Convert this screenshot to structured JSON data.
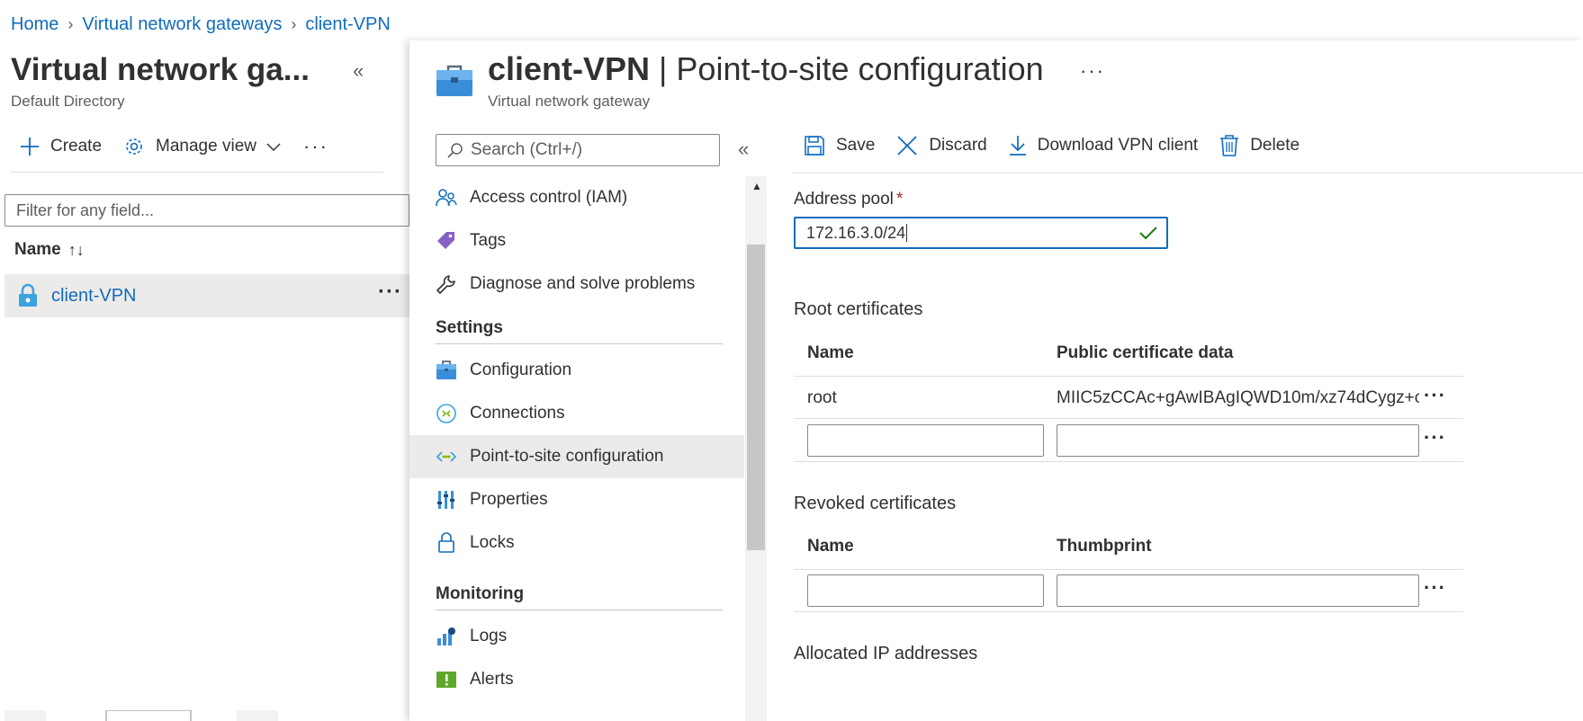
{
  "breadcrumb": [
    "Home",
    "Virtual network gateways",
    "client-VPN"
  ],
  "left_blade": {
    "title": "Virtual network ga...",
    "subtitle": "Default Directory",
    "collapse": "«",
    "toolbar": {
      "create": "Create",
      "manage_view": "Manage view",
      "more": "···"
    },
    "filter_placeholder": "Filter for any field...",
    "column_name": "Name",
    "sort_indicator": "↑↓",
    "rows": [
      {
        "name": "client-VPN",
        "more": "···"
      }
    ]
  },
  "blade": {
    "resource": "client-VPN",
    "separator": " | ",
    "page": "Point-to-site configuration",
    "subtitle": "Virtual network gateway",
    "more": "···",
    "search_placeholder": "Search (Ctrl+/)",
    "collapse": "«"
  },
  "menu": {
    "items_top": [
      {
        "label": "Access control (IAM)",
        "icon": "people-icon"
      },
      {
        "label": "Tags",
        "icon": "tag-icon"
      },
      {
        "label": "Diagnose and solve problems",
        "icon": "wrench-icon"
      }
    ],
    "section_settings": "Settings",
    "items_settings": [
      {
        "label": "Configuration",
        "icon": "toolbox-icon"
      },
      {
        "label": "Connections",
        "icon": "connections-icon"
      },
      {
        "label": "Point-to-site configuration",
        "icon": "p2s-icon",
        "selected": true
      },
      {
        "label": "Properties",
        "icon": "properties-icon"
      },
      {
        "label": "Locks",
        "icon": "lock-icon"
      }
    ],
    "section_monitoring": "Monitoring",
    "items_monitoring": [
      {
        "label": "Logs",
        "icon": "logs-icon"
      },
      {
        "label": "Alerts",
        "icon": "alerts-icon"
      }
    ]
  },
  "toolbar": {
    "save": "Save",
    "discard": "Discard",
    "download": "Download VPN client",
    "delete": "Delete"
  },
  "form": {
    "address_pool_label": "Address pool",
    "required_mark": "*",
    "address_pool_value": "172.16.3.0/24",
    "root_certificates": {
      "title": "Root certificates",
      "col_name": "Name",
      "col_data": "Public certificate data",
      "rows": [
        {
          "name": "root",
          "data": "MIIC5zCCAc+gAwIBAgIQWD10m/xz74dCygz+c"
        }
      ]
    },
    "revoked_certificates": {
      "title": "Revoked certificates",
      "col_name": "Name",
      "col_thumb": "Thumbprint"
    },
    "allocated_ip": "Allocated IP addresses",
    "row_more": "···"
  },
  "colors": {
    "link": "#0f6cbd",
    "selected_bg": "#edebe9",
    "required": "#a4262c",
    "valid": "#107c10"
  }
}
